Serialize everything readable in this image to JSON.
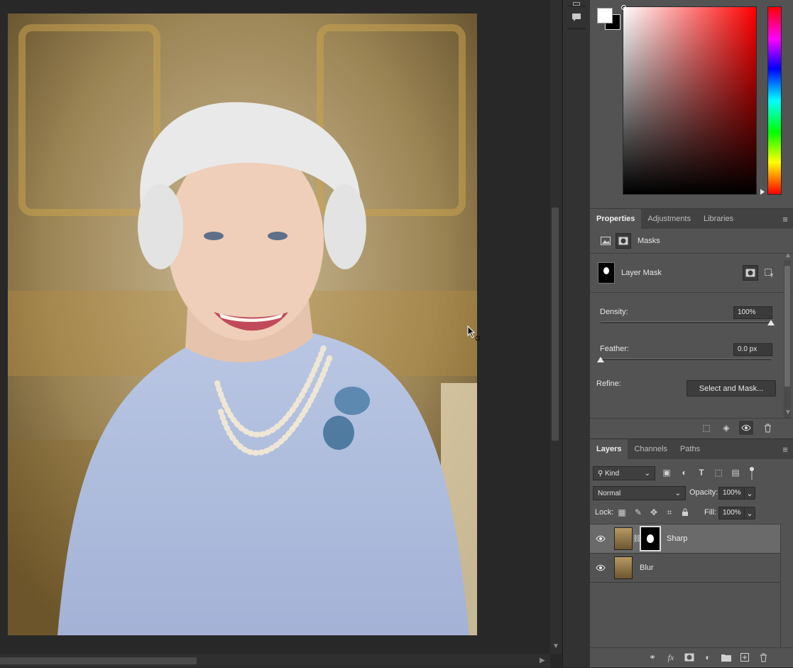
{
  "properties": {
    "tabs": [
      "Properties",
      "Adjustments",
      "Libraries"
    ],
    "section_label": "Masks",
    "mask_name": "Layer Mask",
    "density_label": "Density:",
    "density_value": "100%",
    "feather_label": "Feather:",
    "feather_value": "0.0 px",
    "refine_label": "Refine:",
    "select_and_mask_label": "Select and Mask..."
  },
  "layers_panel": {
    "tabs": [
      "Layers",
      "Channels",
      "Paths"
    ],
    "filter_kind": "Kind",
    "blend_mode": "Normal",
    "opacity_label": "Opacity:",
    "opacity_value": "100%",
    "lock_label": "Lock:",
    "fill_label": "Fill:",
    "fill_value": "100%",
    "layers": [
      {
        "name": "Sharp",
        "has_mask": true,
        "selected": true,
        "visible": true
      },
      {
        "name": "Blur",
        "has_mask": false,
        "selected": false,
        "visible": true
      }
    ]
  },
  "colors": {
    "foreground": "#ffffff",
    "background": "#000000",
    "panel_bg": "#535353",
    "selected_row": "#6a6a6a"
  }
}
